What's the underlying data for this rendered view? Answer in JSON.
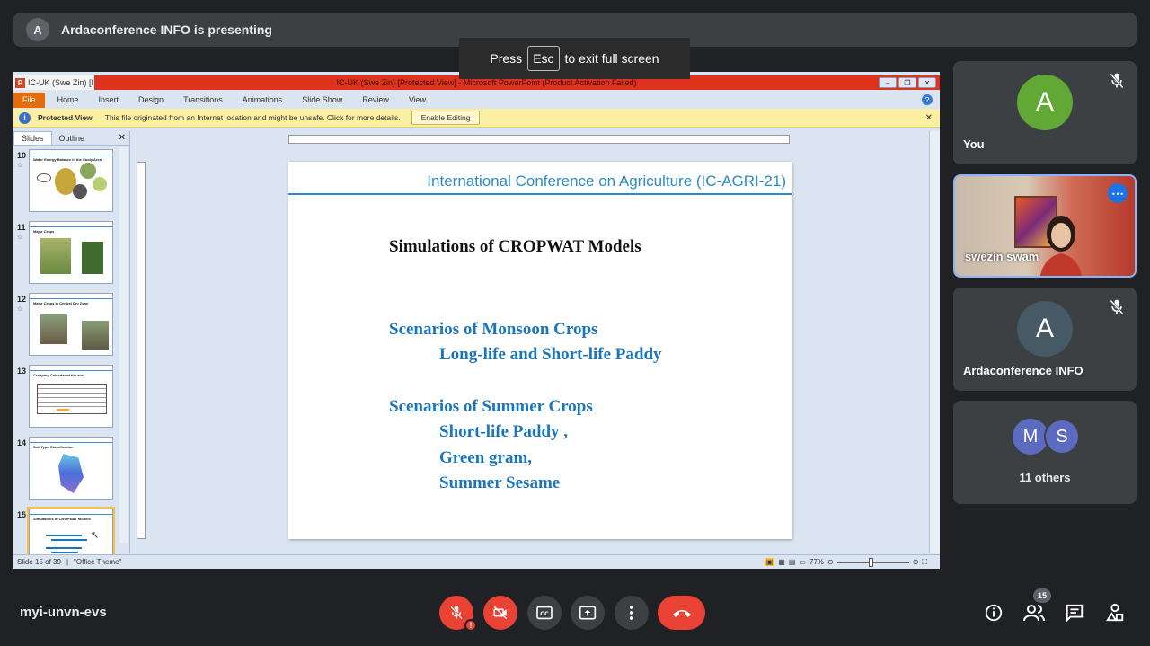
{
  "presenting": {
    "avatar_letter": "A",
    "text": "Ardaconference INFO is presenting"
  },
  "esc_overlay": {
    "press": "Press",
    "key": "Esc",
    "suffix": "to exit full screen"
  },
  "powerpoint": {
    "doc_tab": "IC-UK (Swe Zin) [I",
    "title": "IC-UK (Swe Zin) [Protected View] - Microsoft PowerPoint (Product Activation Failed)",
    "logo_letter": "P",
    "ribbon_tabs": [
      "File",
      "Home",
      "Insert",
      "Design",
      "Transitions",
      "Animations",
      "Slide Show",
      "Review",
      "View"
    ],
    "protected_view": {
      "label": "Protected View",
      "message": "This file originated from an Internet location and might be unsafe. Click for more details.",
      "button": "Enable Editing"
    },
    "panel_tabs": [
      "Slides",
      "Outline"
    ],
    "thumbnails": [
      {
        "num": "10",
        "title": "Water Energy Balance in the Study Area"
      },
      {
        "num": "11",
        "title": "Major Crops"
      },
      {
        "num": "12",
        "title": "Major Crops in Central Dry Zone"
      },
      {
        "num": "13",
        "title": "Cropping Calendar of the area"
      },
      {
        "num": "14",
        "title": "Soil Type Classification"
      },
      {
        "num": "15",
        "title": "Simulations of CROPWAT Models"
      }
    ],
    "slide": {
      "header": "International Conference on Agriculture (IC-AGRI-21)",
      "title": "Simulations of CROPWAT Models",
      "monsoon_heading": "Scenarios of Monsoon Crops",
      "monsoon_item": "Long-life and Short-life Paddy",
      "summer_heading": "Scenarios of Summer Crops",
      "summer_items": [
        "Short-life Paddy ,",
        "Green gram,",
        "Summer Sesame"
      ]
    },
    "status": {
      "slide_info": "Slide 15 of 39",
      "theme": "\"Office Theme\"",
      "zoom": "77%"
    }
  },
  "participants": [
    {
      "name": "You",
      "letter": "A",
      "color": "#61a835",
      "muted": true
    },
    {
      "name": "swezin swam",
      "video": true
    },
    {
      "name": "Ardaconference INFO",
      "letter": "A",
      "color": "#455a64",
      "muted": true
    },
    {
      "others_label": "11 others",
      "letters": [
        "M",
        "S"
      ],
      "colors": [
        "#5c6bc0",
        "#5c6bc0"
      ]
    }
  ],
  "meeting": {
    "code": "myi-unvn-evs",
    "participant_count": "15",
    "warning_mark": "!"
  }
}
